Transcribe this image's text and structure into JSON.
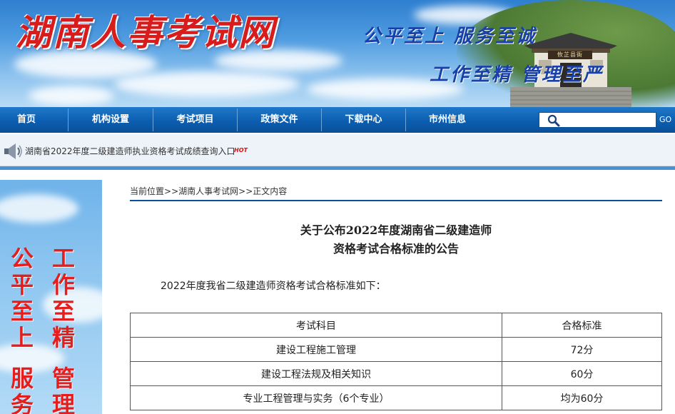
{
  "banner": {
    "site_title": "湖南人事考试网",
    "slogan_1": "公平至上 服务至诚",
    "slogan_2": "工作至精 管理至严",
    "plaque_text": "攸芷县衙"
  },
  "nav": {
    "items": [
      {
        "label": "首页"
      },
      {
        "label": "机构设置"
      },
      {
        "label": "考试项目"
      },
      {
        "label": "政策文件"
      },
      {
        "label": "下载中心"
      },
      {
        "label": "市州信息"
      }
    ],
    "search": {
      "placeholder": "",
      "go_label": "GO"
    }
  },
  "notice": {
    "text": "湖南省2022年度二级建造师执业资格考试成绩查询入口",
    "badge": "HOT"
  },
  "side_banner": {
    "col_left": [
      "公",
      "平",
      "至",
      "上",
      "",
      "服",
      "务"
    ],
    "col_right": [
      "工",
      "作",
      "至",
      "精",
      "",
      "管",
      "理"
    ]
  },
  "breadcrumb": {
    "prefix": "当前位置",
    "sep": ">>",
    "site": "湖南人事考试网",
    "page": "正文内容"
  },
  "article": {
    "title_line_1": "关于公布2022年度湖南省二级建造师",
    "title_line_2": "资格考试合格标准的公告",
    "intro": "2022年度我省二级建造师资格考试合格标准如下：",
    "table": {
      "headers": [
        "考试科目",
        "合格标准"
      ],
      "rows": [
        [
          "建设工程施工管理",
          "72分"
        ],
        [
          "建设工程法规及相关知识",
          "60分"
        ],
        [
          "专业工程管理与实务（6个专业）",
          "均为60分"
        ]
      ]
    }
  },
  "colors": {
    "nav_blue": "#0c5eb0",
    "title_red": "#d81b1b",
    "slogan_blue": "#1840a8",
    "hot_red": "#e01010"
  }
}
